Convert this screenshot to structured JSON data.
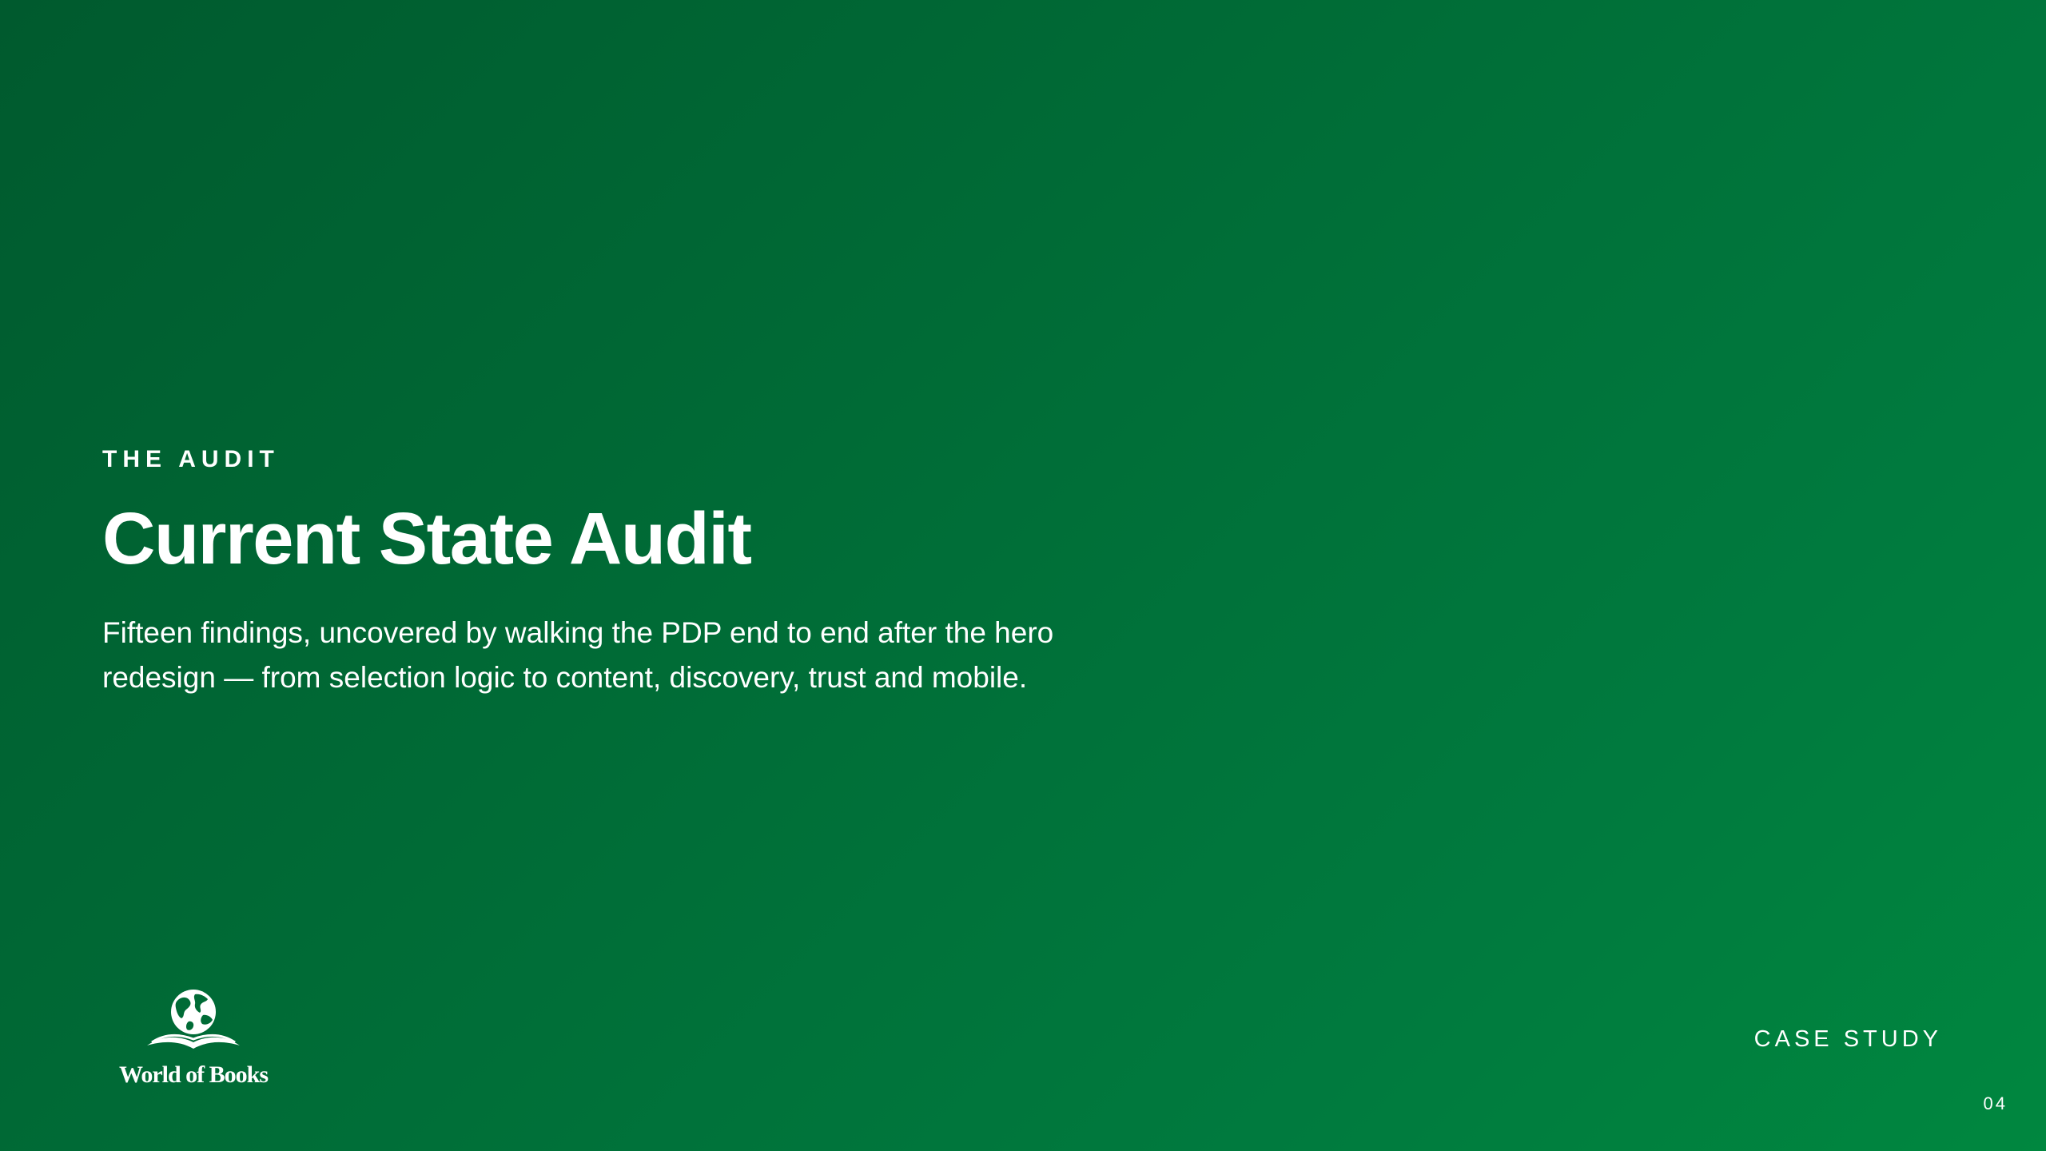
{
  "slide": {
    "eyebrow": "THE AUDIT",
    "title": "Current State Audit",
    "subtitle": "Fifteen findings, uncovered by walking the PDP end to end after the hero redesign — from selection logic to content, discovery, trust and mobile."
  },
  "brand": {
    "logo_text": "World of Books",
    "logo_icon": "globe-open-book-icon"
  },
  "footer": {
    "label": "CASE STUDY",
    "page_number": "04"
  },
  "colors": {
    "background_start": "#005a2e",
    "background_end": "#00873f",
    "text": "#ffffff"
  }
}
